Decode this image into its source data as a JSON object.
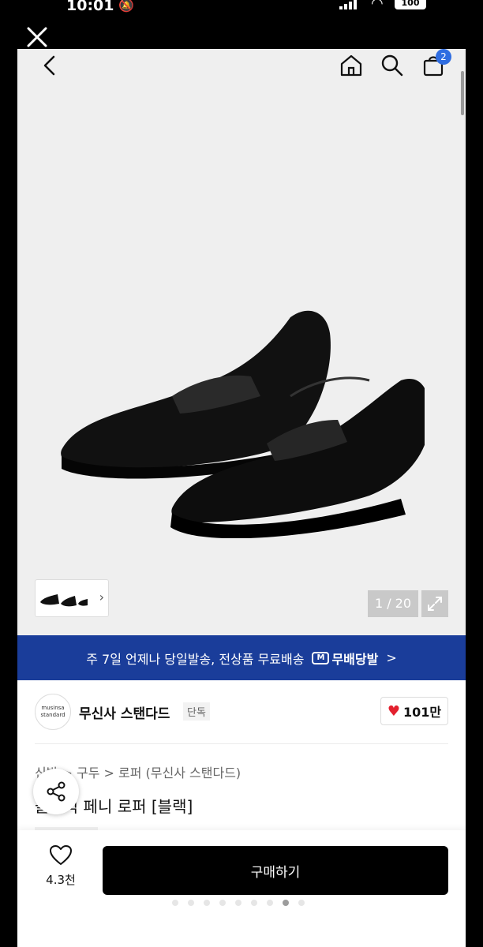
{
  "status_bar": {
    "time": "10:01",
    "battery": "100"
  },
  "nav": {
    "cart_count": "2"
  },
  "gallery": {
    "counter": "1 / 20"
  },
  "banner": {
    "text": "주 7일 언제나 당일발송, 전상품 무료배송",
    "badge_text": "무배당발",
    "chevron": ">"
  },
  "brand": {
    "logo_text": "musinsa standard",
    "name": "무신사 스탠다드",
    "tag": "단독",
    "likes": "101만"
  },
  "breadcrumb": "신발 > 구두 > 로퍼 (무신사 스탠다드)",
  "product": {
    "title": "클래식 페니 로퍼 [블랙]"
  },
  "bottom_bar": {
    "wish_count": "4.3천",
    "buy_label": "구매하기"
  },
  "colors": {
    "banner": "#1a3d9a",
    "badge": "#2f6de1",
    "heart": "#e3202e",
    "buy_button": "#000000"
  },
  "icons": [
    "close-icon",
    "back-icon",
    "home-icon",
    "search-icon",
    "shopping-bag-icon",
    "expand-icon",
    "share-icon",
    "heart-icon"
  ]
}
